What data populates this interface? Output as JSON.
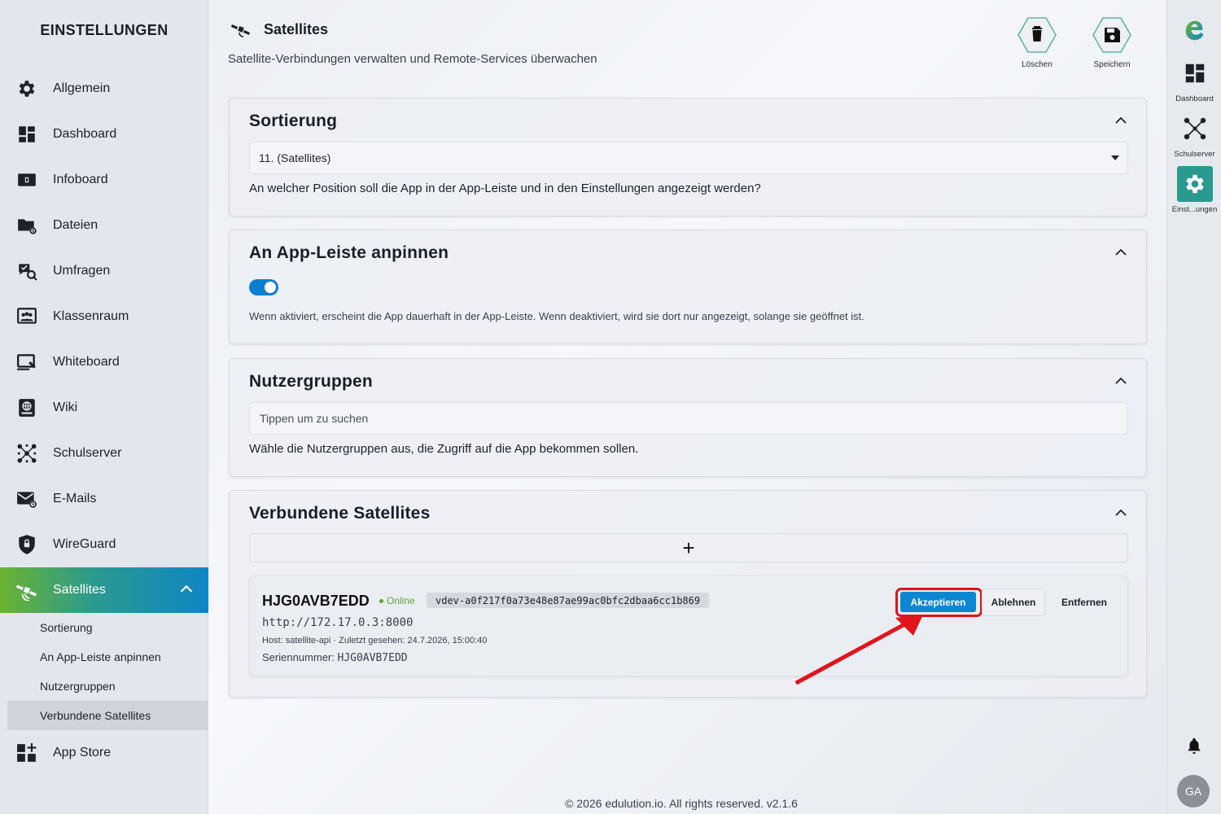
{
  "sidebar": {
    "title": "EINSTELLUNGEN",
    "items": [
      {
        "label": "Allgemein",
        "icon": "gear-icon"
      },
      {
        "label": "Dashboard",
        "icon": "dashboard-icon"
      },
      {
        "label": "Infoboard",
        "icon": "infoboard-icon"
      },
      {
        "label": "Dateien",
        "icon": "folder-icon"
      },
      {
        "label": "Umfragen",
        "icon": "survey-icon"
      },
      {
        "label": "Klassenraum",
        "icon": "classroom-icon"
      },
      {
        "label": "Whiteboard",
        "icon": "whiteboard-icon"
      },
      {
        "label": "Wiki",
        "icon": "wiki-icon"
      },
      {
        "label": "Schulserver",
        "icon": "network-icon"
      },
      {
        "label": "E-Mails",
        "icon": "mail-icon"
      },
      {
        "label": "WireGuard",
        "icon": "shield-icon"
      },
      {
        "label": "Satellites",
        "icon": "satellite-icon"
      }
    ],
    "sub_items": [
      {
        "label": "Sortierung"
      },
      {
        "label": "An App-Leiste anpinnen"
      },
      {
        "label": "Nutzergruppen"
      },
      {
        "label": "Verbundene Satellites"
      }
    ],
    "app_store": {
      "label": "App Store",
      "icon": "app-store-icon"
    }
  },
  "header": {
    "title": "Satellites",
    "subtitle": "Satellite-Verbindungen verwalten und Remote-Services überwachen",
    "delete_label": "Löschen",
    "save_label": "Speichern"
  },
  "sort_card": {
    "title": "Sortierung",
    "selected": "11. (Satellites)",
    "help": "An welcher Position soll die App in der App-Leiste und in den Einstellungen angezeigt werden?"
  },
  "pin_card": {
    "title": "An App-Leiste anpinnen",
    "enabled": true,
    "help": "Wenn aktiviert, erscheint die App dauerhaft in der App-Leiste. Wenn deaktiviert, wird sie dort nur angezeigt, solange sie geöffnet ist."
  },
  "groups_card": {
    "title": "Nutzergruppen",
    "placeholder": "Tippen um zu suchen",
    "help": "Wähle die Nutzergruppen aus, die Zugriff auf die App bekommen sollen."
  },
  "satellites_card": {
    "title": "Verbundene Satellites",
    "add_symbol": "+",
    "items": [
      {
        "name": "HJG0AVB7EDD",
        "status": "Online",
        "token": "vdev-a0f217f0a73e48e87ae99ac0bfc2dbaa6cc1b869",
        "url": "http://172.17.0.3:8000",
        "host_line": "Host: satellite-api · Zuletzt gesehen: 24.7.2026, 15:00:40",
        "serial_label": "Seriennummer:",
        "serial_value": "HJG0AVB7EDD",
        "accept_label": "Akzeptieren",
        "reject_label": "Ablehnen",
        "remove_label": "Entfernen"
      }
    ]
  },
  "footer": "© 2026 edulution.io. All rights reserved. v2.1.6",
  "appbar": {
    "items": [
      {
        "label": "Dashboard",
        "icon": "dashboard-icon"
      },
      {
        "label": "Schulserver",
        "icon": "network-icon"
      },
      {
        "label": "Einst...ungen",
        "icon": "gear-icon"
      }
    ],
    "avatar": "GA"
  },
  "colors": {
    "accent": "#0c86d0",
    "active_gradient_start": "#6bb32f",
    "active_gradient_end": "#0f86c4",
    "online": "#5aa83a",
    "highlight": "#e0141b"
  }
}
